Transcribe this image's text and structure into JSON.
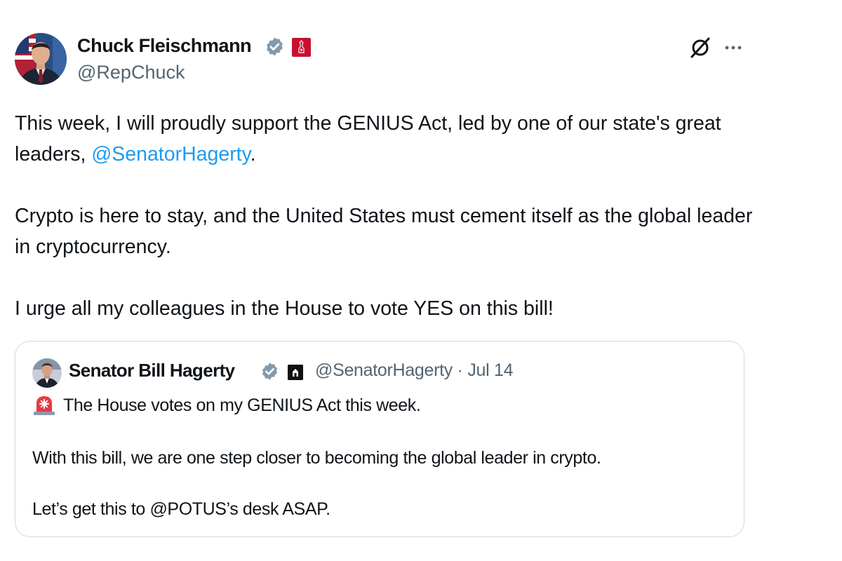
{
  "tweet": {
    "author": {
      "display_name": "Chuck Fleischmann",
      "handle": "@RepChuck"
    },
    "paragraphs": {
      "p1_text": "This week, I will proudly support the GENIUS Act, led by one of our state's great leaders, ",
      "p1_mention": "@SenatorHagerty",
      "p1_end": ".",
      "p2": "Crypto is here to stay, and the United States must cement itself as the global leader in cryptocurrency.",
      "p3": "I urge all my colleagues in the House to vote YES on this bill!"
    }
  },
  "quoted_tweet": {
    "display_name": "Senator Bill Hagerty",
    "handle": "@SenatorHagerty",
    "separator": "·",
    "date": "Jul 14",
    "line1": "The House votes on my GENIUS Act this week.",
    "line2": "With this bill, we are one step closer to becoming the global leader in crypto.",
    "line3": "Let’s get this to @POTUS’s desk ASAP."
  },
  "icons": {
    "verified": "verified-badge-icon",
    "affiliate": "house-of-representatives-seal-icon",
    "grok": "grok-icon",
    "more": "more-options-icon",
    "siren": "rotating-light-emoji"
  },
  "colors": {
    "text": "#0f1419",
    "secondary_text": "#536471",
    "link": "#1d9bf0",
    "verified_badge": "#829aab",
    "border": "#cfd9de",
    "affiliate_badge_red": "#c8102e"
  }
}
